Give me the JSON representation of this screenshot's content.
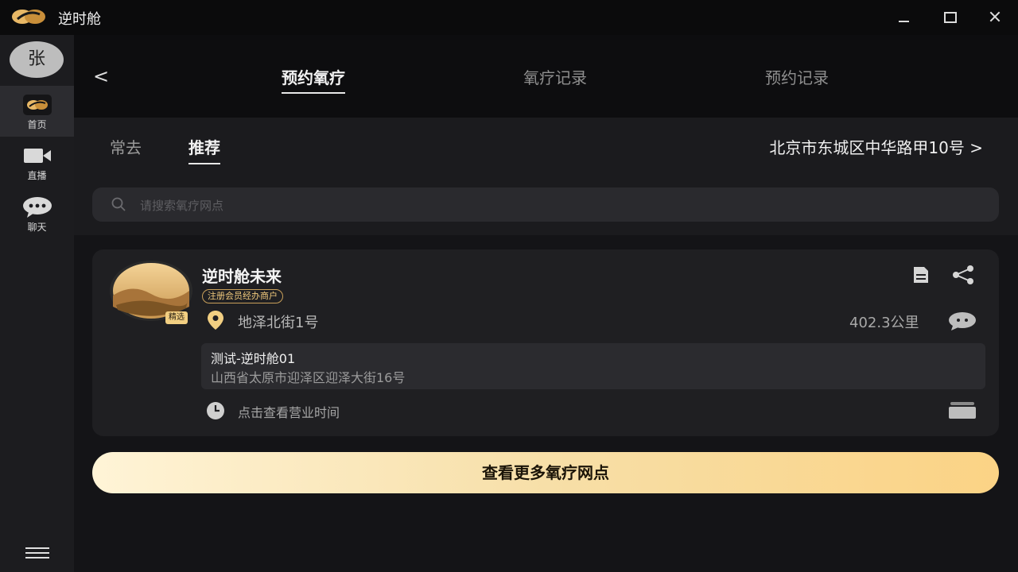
{
  "app": {
    "title": "逆时舱"
  },
  "sidebar": {
    "avatar_text": "张",
    "items": [
      {
        "label": "首页",
        "icon": "home-logo-icon"
      },
      {
        "label": "直播",
        "icon": "video-camera-icon"
      },
      {
        "label": "聊天",
        "icon": "chat-bubble-icon"
      }
    ]
  },
  "header": {
    "back_label": "<",
    "tabs": [
      {
        "label": "预约氧疗",
        "active": true
      },
      {
        "label": "氧疗记录",
        "active": false
      },
      {
        "label": "预约记录",
        "active": false
      }
    ]
  },
  "filter": {
    "tabs": [
      {
        "label": "常去",
        "active": false
      },
      {
        "label": "推荐",
        "active": true
      }
    ],
    "location": "北京市东城区中华路甲10号 >"
  },
  "search": {
    "placeholder": "请搜索氧疗网点",
    "value": ""
  },
  "store": {
    "name": "逆时舱未来",
    "featured_badge": "精选",
    "member_tag": "注册会员经办商户",
    "street": "地泽北街1号",
    "distance": "402.3公里",
    "branch_name": "测试-逆时舱01",
    "branch_address": "山西省太原市迎泽区迎泽大街16号",
    "hours_link": "点击查看营业时间"
  },
  "more_button": {
    "label": "查看更多氧疗网点"
  },
  "colors": {
    "accent_gold": "#f2cf82",
    "background": "#0d0d0f",
    "card": "#1f1f22"
  }
}
